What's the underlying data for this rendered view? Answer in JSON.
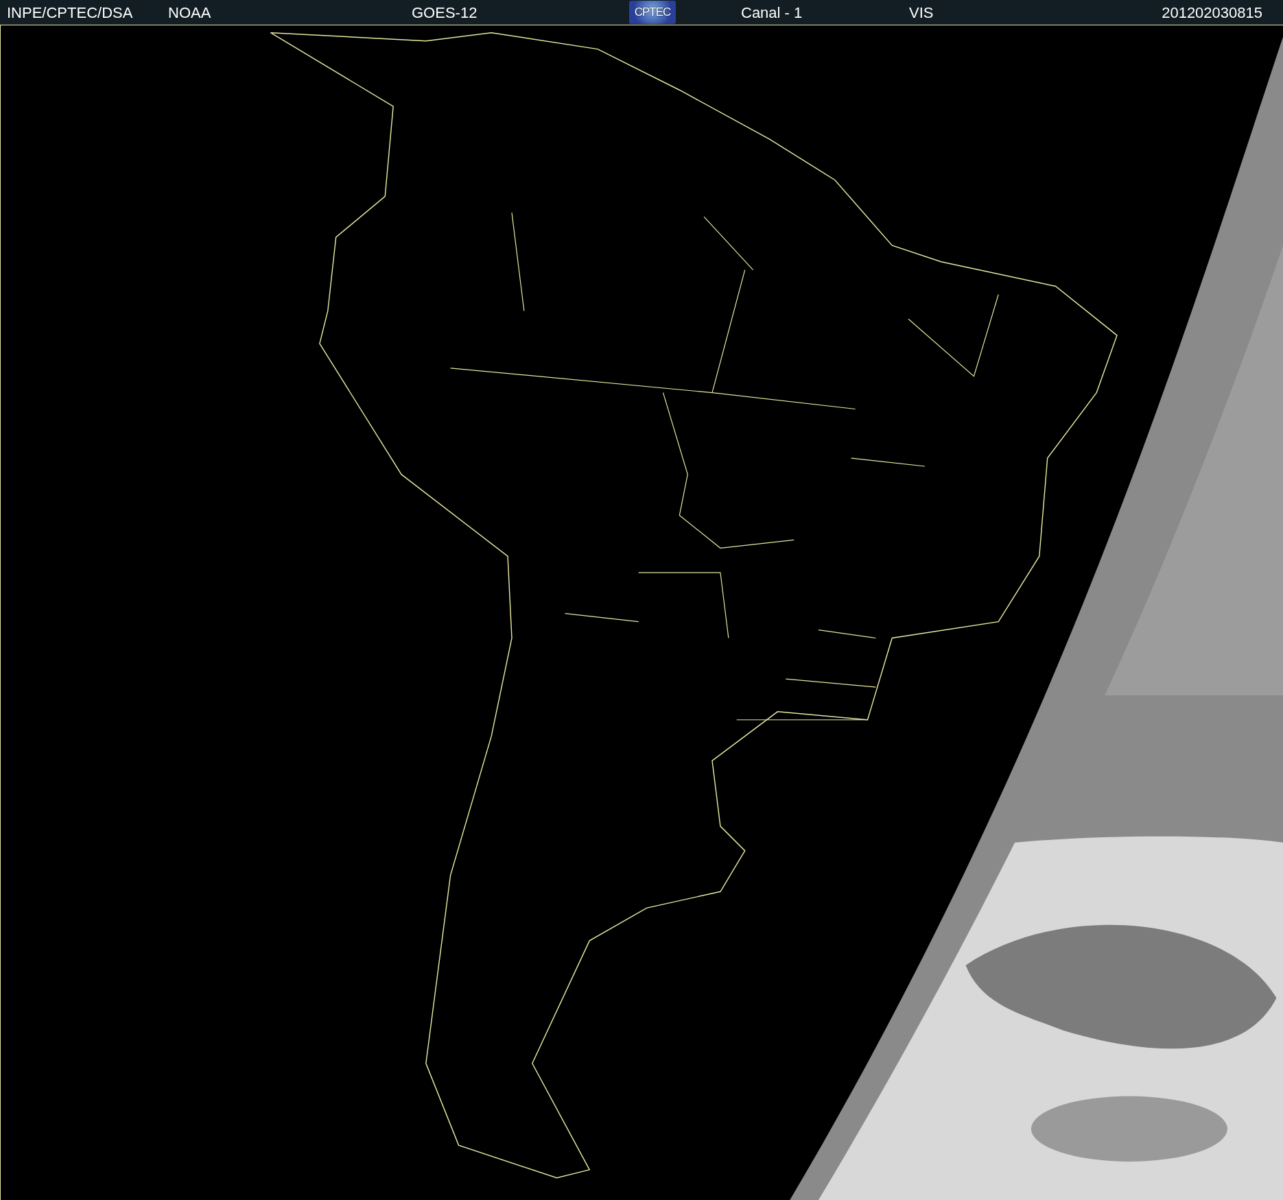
{
  "header": {
    "items": [
      {
        "text": "INPE/CPTEC/DSA"
      },
      {
        "text": "NOAA"
      },
      {
        "text": "GOES-12"
      },
      {
        "text": "CPTEC",
        "kind": "logo"
      },
      {
        "text": "Canal - 1"
      },
      {
        "text": "VIS"
      },
      {
        "text": "201202030815"
      }
    ]
  }
}
